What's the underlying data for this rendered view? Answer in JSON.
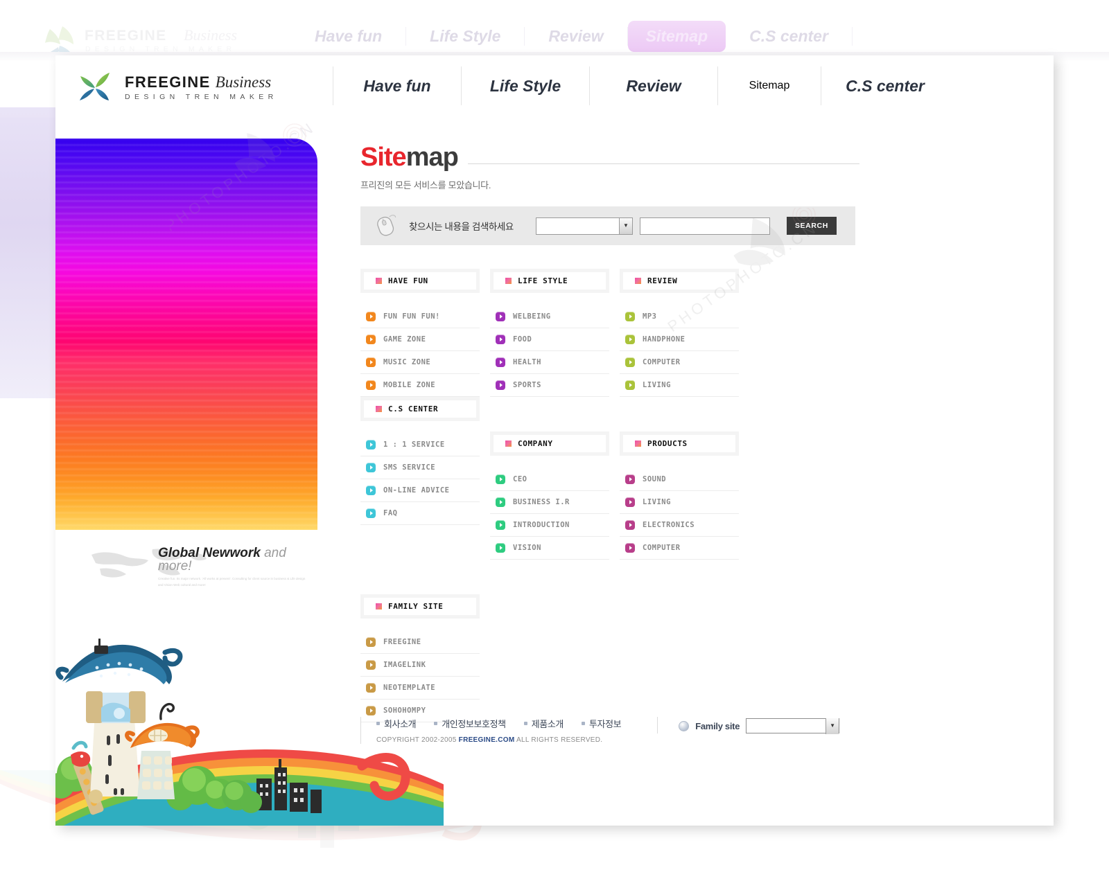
{
  "site": {
    "logo_name": "FREEGINE",
    "logo_sub_italic": "Business",
    "logo_tagline": "DESIGN TREN MAKER"
  },
  "nav": {
    "items": [
      {
        "label": "Have fun",
        "active": false
      },
      {
        "label": "Life Style",
        "active": false
      },
      {
        "label": "Review",
        "active": false
      },
      {
        "label": "Sitemap",
        "active": true
      },
      {
        "label": "C.S center",
        "active": false
      }
    ],
    "active_color": "#c13fdd"
  },
  "page": {
    "title_part1": "Site",
    "title_part2": "map",
    "title_color": "#e8262d",
    "subtitle": "프리진의 모든 서비스를 모았습니다."
  },
  "search": {
    "label": "찾으시는 내용을 검색하세요",
    "select_value": "",
    "input_value": "",
    "input_placeholder": "",
    "button_label": "SEARCH",
    "icon": "mouse-icon"
  },
  "banner": {
    "headline_bold": "Global Newwork",
    "headline_light": " and more!",
    "body": "Creative fun. Its major network. 'All works at present'. Consulting for client source in business & Life design and Vision Web cultural and more!"
  },
  "sitemap": {
    "columns": [
      {
        "title": "HAVE FUN",
        "accent": "#f2871d",
        "items": [
          "FUN FUN FUN!",
          "GAME ZONE",
          "MUSIC ZONE",
          "MOBILE ZONE"
        ]
      },
      {
        "title": "LIFE STYLE",
        "accent": "#a030b8",
        "items": [
          "WELBEING",
          "FOOD",
          "HEALTH",
          "SPORTS"
        ]
      },
      {
        "title": "REVIEW",
        "accent": "#aac33a",
        "items": [
          "MP3",
          "HANDPHONE",
          "COMPUTER",
          "LIVING"
        ]
      },
      {
        "title": "C.S CENTER",
        "accent": "#3ec6d8",
        "items": [
          "1 : 1 SERVICE",
          "SMS SERVICE",
          "ON-LINE ADVICE",
          "FAQ"
        ]
      },
      {
        "title": "COMPANY",
        "accent": "#2ecc80",
        "items": [
          "CEO",
          "BUSINESS I.R",
          "INTRODUCTION",
          "VISION"
        ]
      },
      {
        "title": "PRODUCTS",
        "accent": "#b83e8a",
        "items": [
          "SOUND",
          "LIVING",
          "ELECTRONICS",
          "COMPUTER"
        ]
      },
      {
        "title": "FAMILY SITE",
        "accent": "#c99a46",
        "items": [
          "FREEGINE",
          "IMAGELINK",
          "NEOTEMPLATE",
          "SOHOHOMPY"
        ]
      }
    ]
  },
  "footer": {
    "links": [
      "회사소개",
      "개인정보보호정책",
      "제품소개",
      "투자정보"
    ],
    "copyright_pre": "COPYRIGHT 2002-2005 ",
    "copyright_brand": "FREEGINE.COM",
    "copyright_post": " ALL RIGHTS RESERVED.",
    "family_site_label": "Family site",
    "family_site_value": ""
  },
  "watermark": {
    "text": "PHOTOPHOTO.CN"
  }
}
